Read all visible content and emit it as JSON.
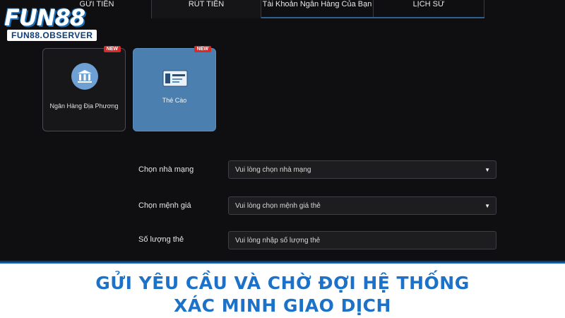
{
  "logo": {
    "main": "FUN88",
    "sub": "FUN88.OBSERVER"
  },
  "tabs": [
    {
      "label": "GỬI TIỀN"
    },
    {
      "label": "RÚT TIỀN"
    },
    {
      "label": "Tài Khoản Ngân Hàng Của Bạn"
    },
    {
      "label": "LỊCH SỬ"
    }
  ],
  "methods": [
    {
      "label": "Ngân Hàng Địa Phương",
      "badge": "NEW",
      "icon": "bank-icon"
    },
    {
      "label": "Thẻ Cào",
      "badge": "NEW",
      "icon": "card-icon"
    }
  ],
  "form": {
    "network": {
      "label": "Chọn nhà mạng",
      "value": "Vui lòng chọn nhà mạng"
    },
    "denomination": {
      "label": "Chọn mệnh giá",
      "value": "Vui lòng chọn mệnh giá thẻ"
    },
    "quantity": {
      "label": "Số lượng thẻ",
      "placeholder": "Vui lòng nhập số lượng thẻ"
    }
  },
  "banner": {
    "line1": "GỬI YÊU CẦU VÀ CHỜ ĐỢI HỆ THỐNG",
    "line2": "XÁC MINH GIAO DỊCH"
  },
  "colors": {
    "accent": "#1b72c8",
    "selected_card": "#4a7fb0",
    "badge": "#d42b2b"
  }
}
